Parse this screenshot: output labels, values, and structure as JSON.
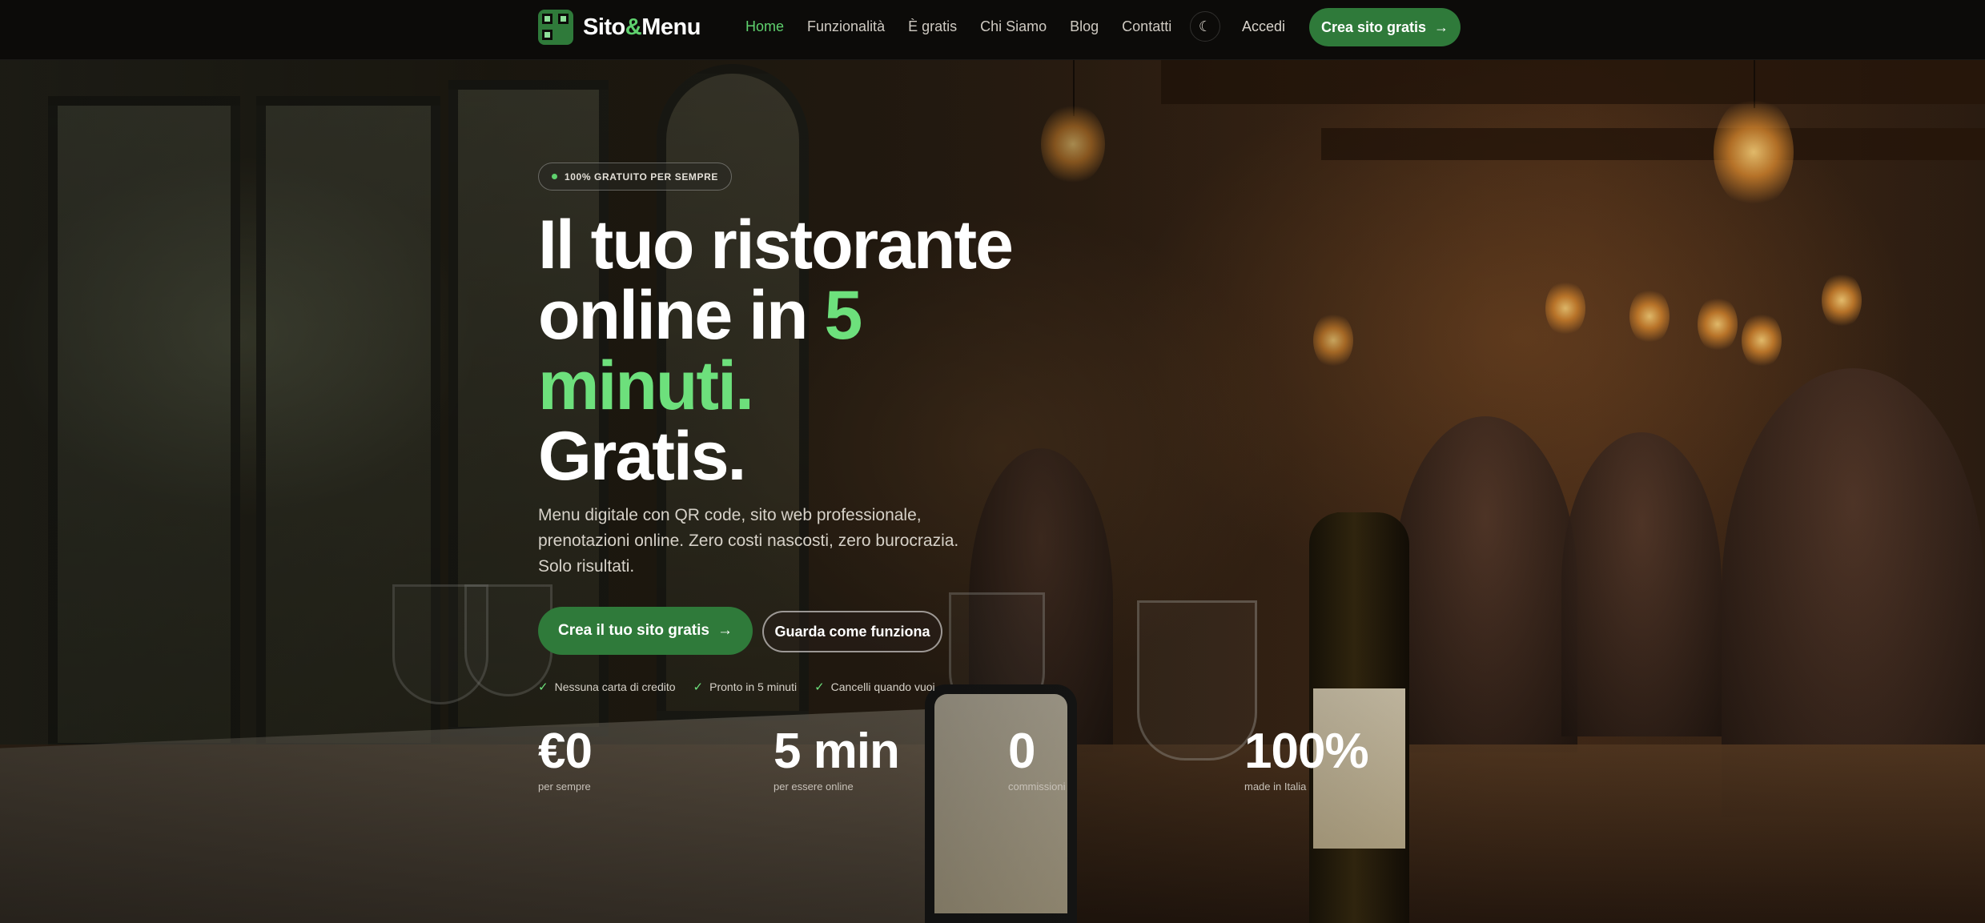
{
  "brand": {
    "name_part1": "Sito",
    "name_amp": "&",
    "name_part2": "Menu"
  },
  "nav": {
    "links": [
      "Home",
      "Funzionalità",
      "È gratis",
      "Chi Siamo",
      "Blog",
      "Contatti"
    ],
    "active": "Home",
    "login": "Accedi",
    "cta": "Crea sito gratis",
    "cta_arrow": "→",
    "theme_icon": "moon-icon"
  },
  "hero": {
    "badge": "100% GRATUITO PER SEMPRE",
    "headline_line1": "Il tuo ristorante",
    "headline_line2_a": "online in ",
    "headline_line2_b": "5",
    "headline_line3": "minuti.",
    "headline_line4": "Gratis.",
    "subtitle": "Menu digitale con QR code, sito web professionale, prenotazioni online. Zero costi nascosti, zero burocrazia. Solo risultati.",
    "primary_cta": "Crea il tuo sito gratis",
    "primary_cta_arrow": "→",
    "secondary_cta": "Guarda come funziona",
    "checks": [
      "Nessuna carta di credito",
      "Pronto in 5 minuti",
      "Cancelli quando vuoi"
    ]
  },
  "stats": [
    {
      "value": "€0",
      "label": "per sempre"
    },
    {
      "value": "5 min",
      "label": "per essere online"
    },
    {
      "value": "0",
      "label": "commissioni"
    },
    {
      "value": "100%",
      "label": "made in Italia"
    }
  ],
  "colors": {
    "accent": "#5fd16e",
    "button": "#2f7a3a",
    "navbar": "#0c0b09"
  }
}
